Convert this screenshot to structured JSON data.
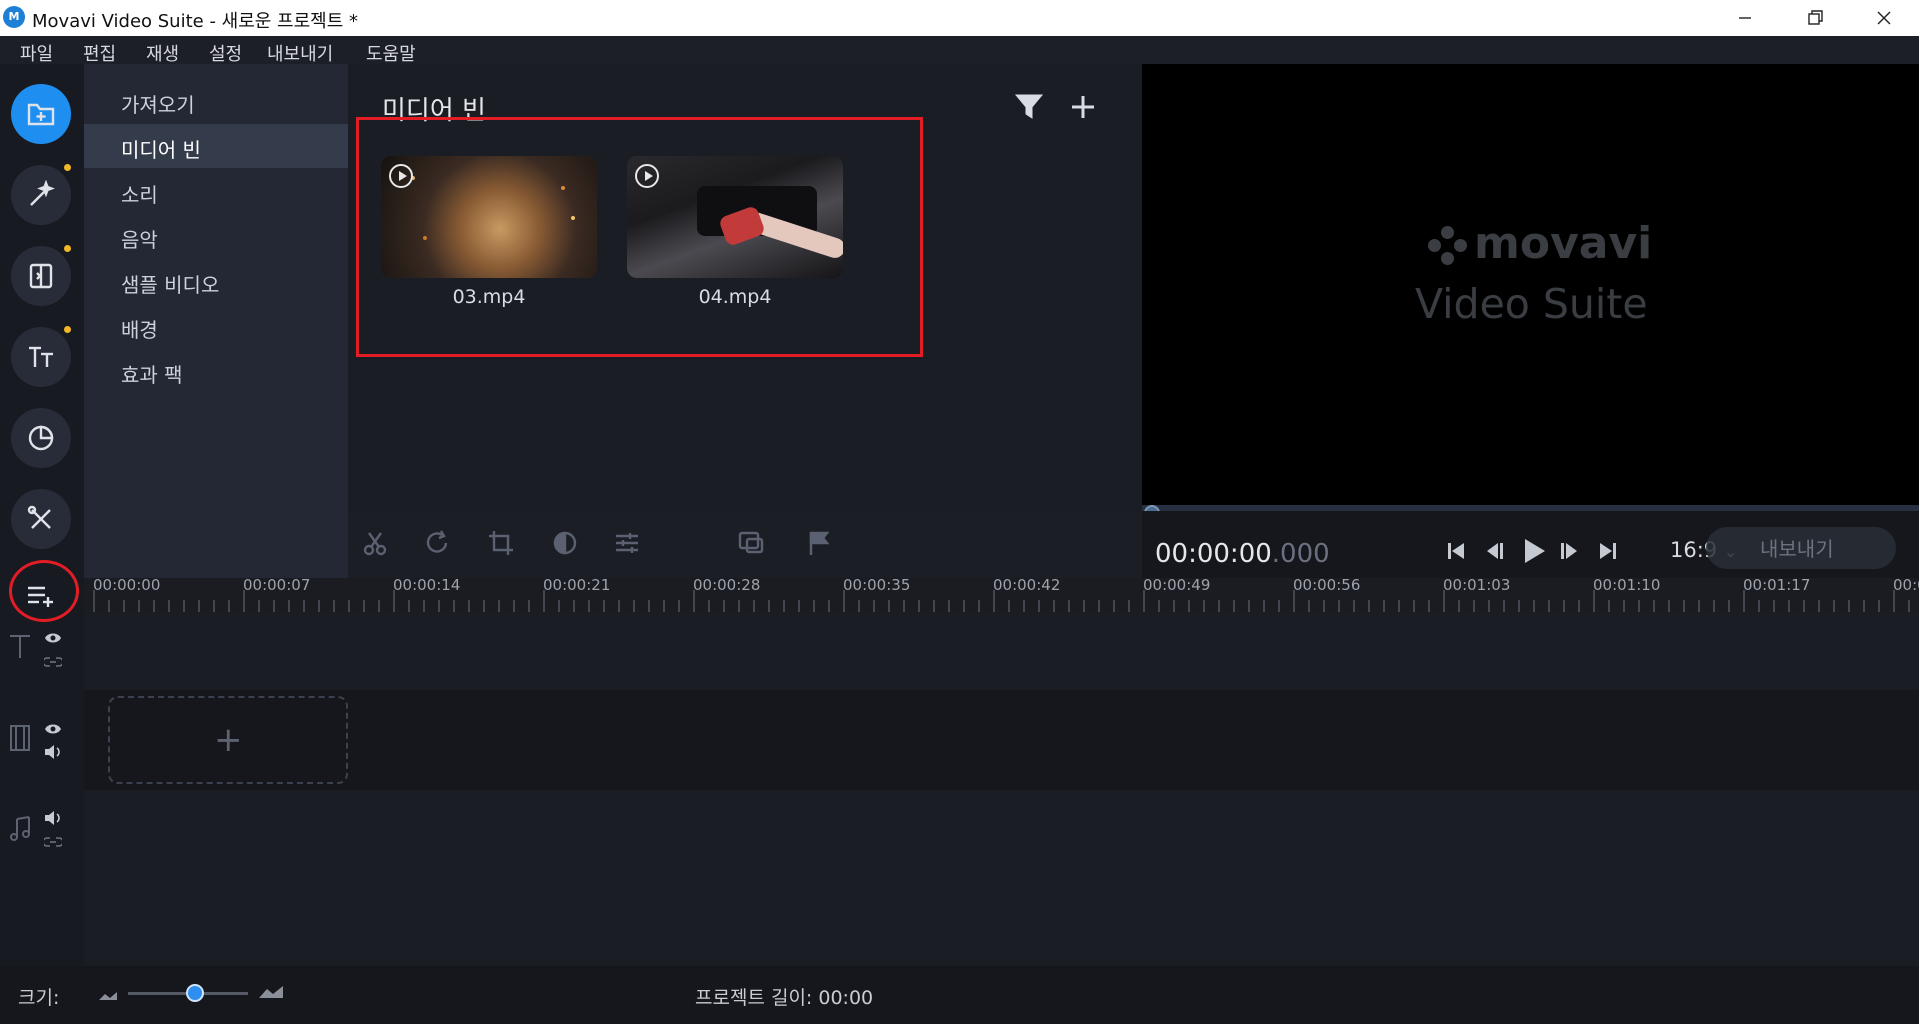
{
  "window": {
    "title": "Movavi Video Suite - 새로운 프로젝트 *",
    "logo_text": "M"
  },
  "menu": [
    "파일",
    "편집",
    "재생",
    "설정",
    "내보내기",
    "도움말"
  ],
  "sidebar": {
    "categories": [
      "가져오기",
      "미디어 빈",
      "소리",
      "음악",
      "샘플 비디오",
      "배경",
      "효과 팩"
    ],
    "selected": "미디어 빈"
  },
  "media_bin": {
    "title": "미디어 빈",
    "items": [
      {
        "name": "03.mp4",
        "colors": [
          "#2d2520",
          "#6b4a2a",
          "#c89a62"
        ]
      },
      {
        "name": "04.mp4",
        "colors": [
          "#1c1c1f",
          "#3a3a40",
          "#b5b3b0"
        ]
      }
    ]
  },
  "preview": {
    "watermark_brand": "movavi",
    "watermark_sub": "Video Suite",
    "timecode_main": "00:00:00",
    "timecode_ms": ".000",
    "aspect_ratio": "16:9",
    "export_label": "내보내기"
  },
  "timeline": {
    "ruler_labels": [
      "00:00:00",
      "00:00:07",
      "00:00:14",
      "00:00:21",
      "00:00:28",
      "00:00:35",
      "00:00:42",
      "00:00:49",
      "00:00:56",
      "00:01:03",
      "00:01:10",
      "00:01:17",
      "00:0"
    ],
    "drop_zone_symbol": "+"
  },
  "footer": {
    "size_label": "크기:",
    "project_length": "프로젝트 길이:  00:00"
  },
  "colors": {
    "accent": "#1e8ff0",
    "annotation": "#e21d26",
    "notification_dot": "#f3b828"
  }
}
